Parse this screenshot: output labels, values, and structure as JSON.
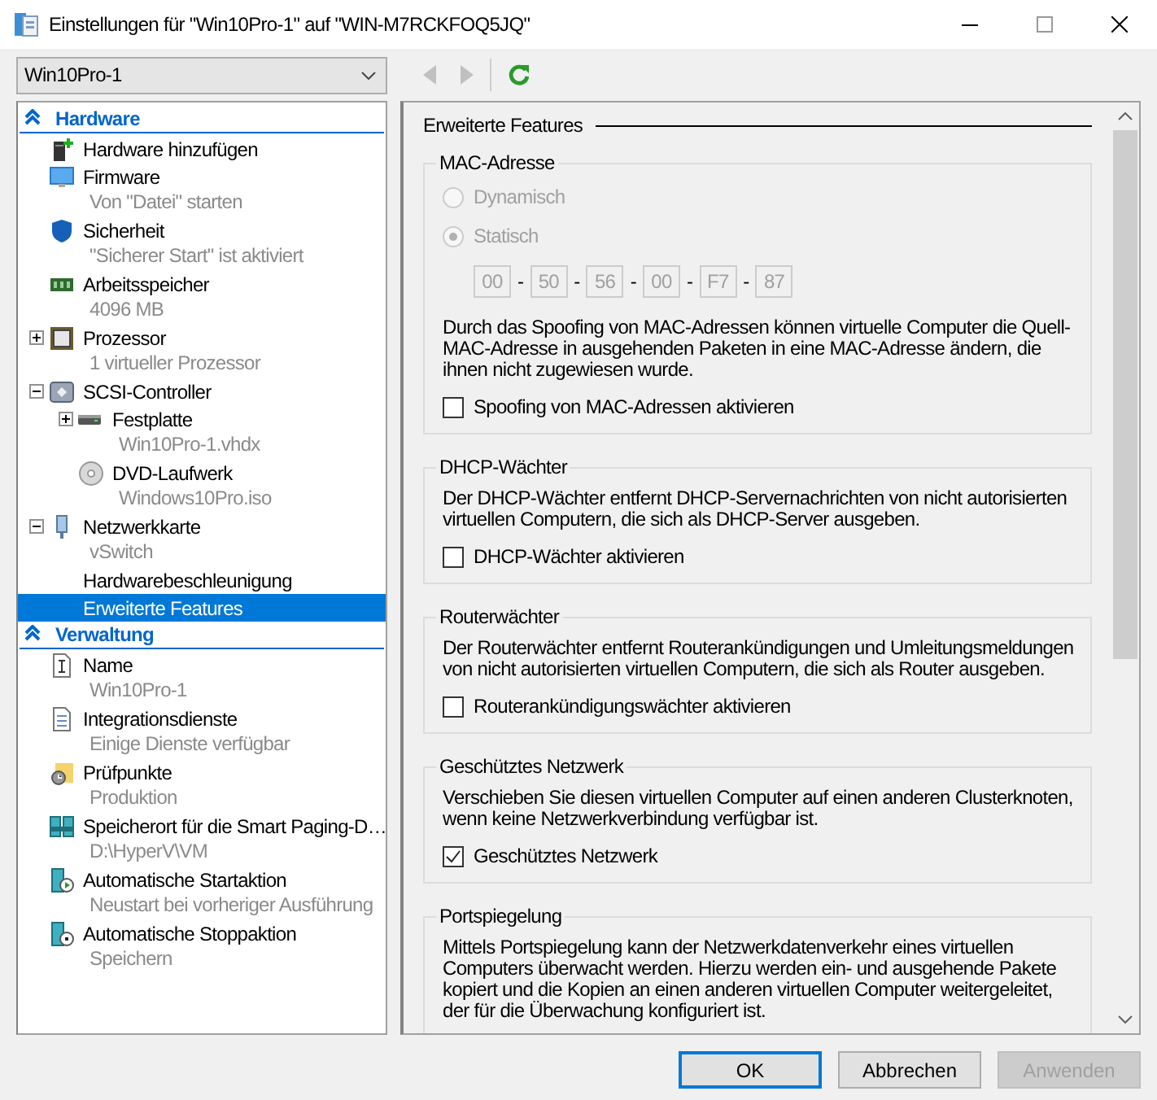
{
  "window": {
    "title": "Einstellungen für \"Win10Pro-1\" auf \"WIN-M7RCKFOQ5JQ\""
  },
  "vm_select": {
    "value": "Win10Pro-1"
  },
  "toolbar": {
    "back_disabled": true,
    "forward_disabled": true
  },
  "sidebar": {
    "sections": [
      {
        "title": "Hardware",
        "expanded": true,
        "items": [
          {
            "label": "Hardware hinzufügen",
            "selected": false
          },
          {
            "label": "Firmware",
            "detail": "Von \"Datei\" starten",
            "selected": false
          },
          {
            "label": "Sicherheit",
            "detail": "\"Sicherer Start\" ist aktiviert",
            "selected": false
          },
          {
            "label": "Arbeitsspeicher",
            "detail": "4096 MB",
            "selected": false
          },
          {
            "label": "Prozessor",
            "detail": "1 virtueller Prozessor",
            "expanded": false,
            "selected": false
          },
          {
            "label": "SCSI-Controller",
            "expanded": true,
            "selected": false,
            "children": [
              {
                "label": "Festplatte",
                "detail": "Win10Pro-1.vhdx",
                "expanded": false,
                "selected": false
              },
              {
                "label": "DVD-Laufwerk",
                "detail": "Windows10Pro.iso",
                "selected": false
              }
            ]
          },
          {
            "label": "Netzwerkkarte",
            "detail": "vSwitch",
            "expanded": true,
            "selected": false,
            "children": [
              {
                "label": "Hardwarebeschleunigung",
                "selected": false
              },
              {
                "label": "Erweiterte Features",
                "selected": true
              }
            ]
          }
        ]
      },
      {
        "title": "Verwaltung",
        "expanded": true,
        "items": [
          {
            "label": "Name",
            "detail": "Win10Pro-1",
            "selected": false
          },
          {
            "label": "Integrationsdienste",
            "detail": "Einige Dienste verfügbar",
            "selected": false
          },
          {
            "label": "Prüfpunkte",
            "detail": "Produktion",
            "selected": false
          },
          {
            "label": "Speicherort für die Smart Paging-D…",
            "detail": "D:\\HyperV\\VM",
            "selected": false
          },
          {
            "label": "Automatische Startaktion",
            "detail": "Neustart bei vorheriger Ausführung",
            "selected": false
          },
          {
            "label": "Automatische Stoppaktion",
            "detail": "Speichern",
            "selected": false
          }
        ]
      }
    ]
  },
  "panel": {
    "title": "Erweiterte Features",
    "groups": [
      {
        "kind": "mac",
        "title": "MAC-Adresse",
        "disabled": true,
        "options": [
          {
            "label": "Dynamisch",
            "selected": false
          },
          {
            "label": "Statisch",
            "selected": true
          }
        ],
        "octets": [
          "00",
          "50",
          "56",
          "00",
          "F7",
          "87"
        ],
        "octet_separator": "-",
        "description": "Durch das Spoofing von MAC-Adressen können virtuelle Computer die Quell-MAC-Adresse in ausgehenden Paketen in eine MAC-Adresse ändern, die ihnen nicht zugewiesen wurde.",
        "checkbox": {
          "label": "Spoofing von MAC-Adressen aktivieren",
          "checked": false
        }
      },
      {
        "kind": "option",
        "title": "DHCP-Wächter",
        "description": "Der DHCP-Wächter entfernt DHCP-Servernachrichten von nicht autorisierten virtuellen Computern, die sich als DHCP-Server ausgeben.",
        "checkbox": {
          "label": "DHCP-Wächter aktivieren",
          "checked": false
        }
      },
      {
        "kind": "option",
        "title": "Routerwächter",
        "description": "Der Routerwächter entfernt Routerankündigungen und Umleitungsmeldungen von nicht autorisierten virtuellen Computern, die sich als Router ausgeben.",
        "checkbox": {
          "label": "Routerankündigungswächter aktivieren",
          "checked": false
        }
      },
      {
        "kind": "option",
        "title": "Geschütztes Netzwerk",
        "description": "Verschieben Sie diesen virtuellen Computer auf einen anderen Clusterknoten, wenn keine Netzwerkverbindung verfügbar ist.",
        "checkbox": {
          "label": "Geschütztes Netzwerk",
          "checked": true
        }
      },
      {
        "kind": "option",
        "title": "Portspiegelung",
        "description": "Mittels Portspiegelung kann der Netzwerkdatenverkehr eines virtuellen Computers überwacht werden. Hierzu werden ein- und ausgehende Pakete kopiert und die Kopien an einen anderen virtuellen Computer weitergeleitet, der für die Überwachung konfiguriert ist."
      }
    ]
  },
  "buttons": [
    {
      "label": "OK",
      "default": true,
      "disabled": false
    },
    {
      "label": "Abbrechen",
      "default": false,
      "disabled": false
    },
    {
      "label": "Anwenden",
      "default": false,
      "disabled": true
    }
  ]
}
